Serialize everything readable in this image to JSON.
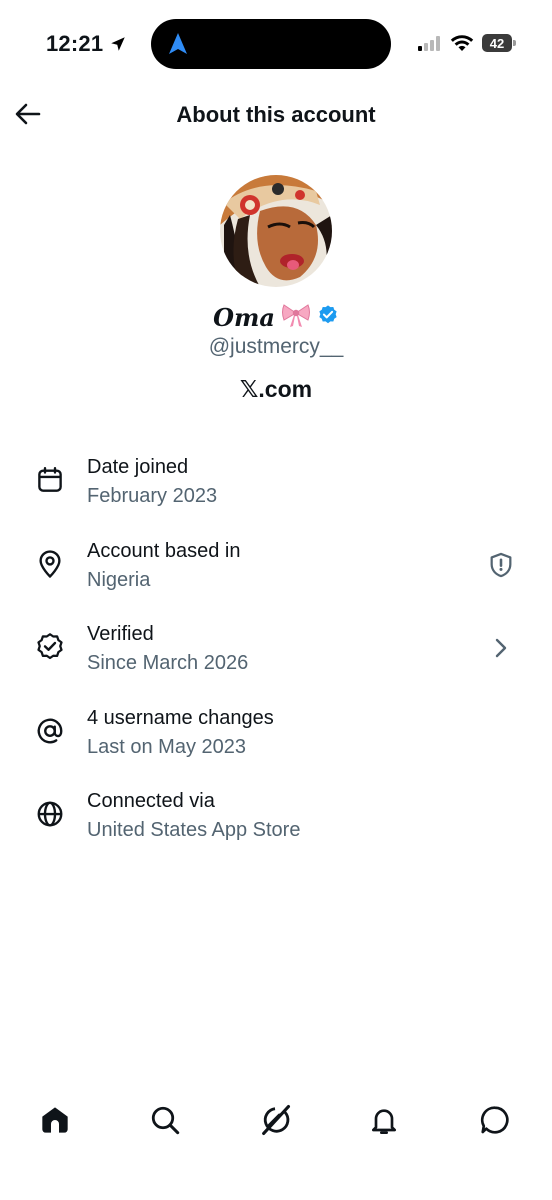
{
  "status_bar": {
    "time": "12:21",
    "battery": "42"
  },
  "header": {
    "title": "About this account"
  },
  "profile": {
    "display_name": "Oma",
    "handle": "@justmercy__",
    "site": "𝕏.com"
  },
  "info": [
    {
      "icon": "calendar-icon",
      "title": "Date joined",
      "subtitle": "February 2023"
    },
    {
      "icon": "location-pin-icon",
      "title": "Account based in",
      "subtitle": "Nigeria",
      "trailing": "shield-alert-icon"
    },
    {
      "icon": "verified-check-icon",
      "title": "Verified",
      "subtitle": "Since March 2026",
      "trailing": "chevron-right-icon"
    },
    {
      "icon": "at-sign-icon",
      "title": "4 username changes",
      "subtitle": "Last on May 2023"
    },
    {
      "icon": "globe-icon",
      "title": "Connected via",
      "subtitle": "United States App Store"
    }
  ],
  "bottom_nav": [
    "home-icon",
    "search-icon",
    "grok-icon",
    "notifications-bell-icon",
    "messages-icon"
  ],
  "colors": {
    "text_primary": "#0f1419",
    "text_secondary": "#536471",
    "verified_blue": "#1d9bf0",
    "background": "#ffffff"
  }
}
